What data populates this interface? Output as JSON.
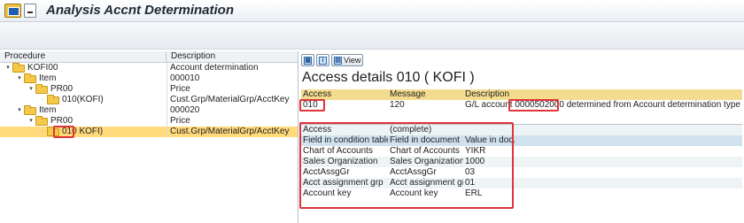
{
  "window": {
    "title": "Analysis Accnt Determination"
  },
  "tree": {
    "columns": {
      "procedure": "Procedure",
      "description": "Description"
    },
    "rows": [
      {
        "label": "KOFI00",
        "desc": "Account determination",
        "level": 0,
        "toggle": "▾"
      },
      {
        "label": "Item",
        "desc": "000010",
        "level": 1,
        "toggle": "▾"
      },
      {
        "label": "PR00",
        "desc": "Price",
        "level": 2,
        "toggle": "▾"
      },
      {
        "label": "010(KOFI)",
        "desc": "Cust.Grp/MaterialGrp/AcctKey",
        "level": 3,
        "toggle": "·"
      },
      {
        "label": "Item",
        "desc": "000020",
        "level": 1,
        "toggle": "▾"
      },
      {
        "label": "PR00",
        "desc": "Price",
        "level": 2,
        "toggle": "▾"
      },
      {
        "label": "010 KOFI)",
        "desc": "Cust.Grp/MaterialGrp/AcctKey",
        "level": 3,
        "toggle": "·",
        "selected": true
      }
    ]
  },
  "detail": {
    "toolbar": {
      "btn1_icon": "grid-icon",
      "btn2_icon": "info-icon",
      "view_label": "View"
    },
    "heading": "Access details 010 ( KOFI )",
    "top_table": {
      "headers": [
        "Access",
        "Message",
        "Description"
      ],
      "row": {
        "access": "010",
        "message": "120",
        "desc_prefix": "G/L account ",
        "account": "0000502000",
        "desc_suffix": " determined from Account determination type KOFI"
      }
    },
    "access_table": {
      "access_label": "Access",
      "access_status": "(complete)",
      "headers": [
        "Field in condition table",
        "Field in document",
        "Value in doc."
      ],
      "rows": [
        [
          "Chart of Accounts",
          "Chart of Accounts",
          "YIKR"
        ],
        [
          "Sales Organization",
          "Sales Organization",
          "1000"
        ],
        [
          "AcctAssgGr",
          "AcctAssgGr",
          "03"
        ],
        [
          "Acct assignment grp",
          "Acct assignment grp",
          "01"
        ],
        [
          "Account key",
          "Account key",
          "ERL"
        ]
      ]
    }
  },
  "colors": {
    "highlight_red": "#e0343a",
    "selected_row": "#ffd97a",
    "folder": "#f5c84a",
    "header_blue": "#cfe2ee",
    "header_yellow": "#f4dc8f"
  }
}
